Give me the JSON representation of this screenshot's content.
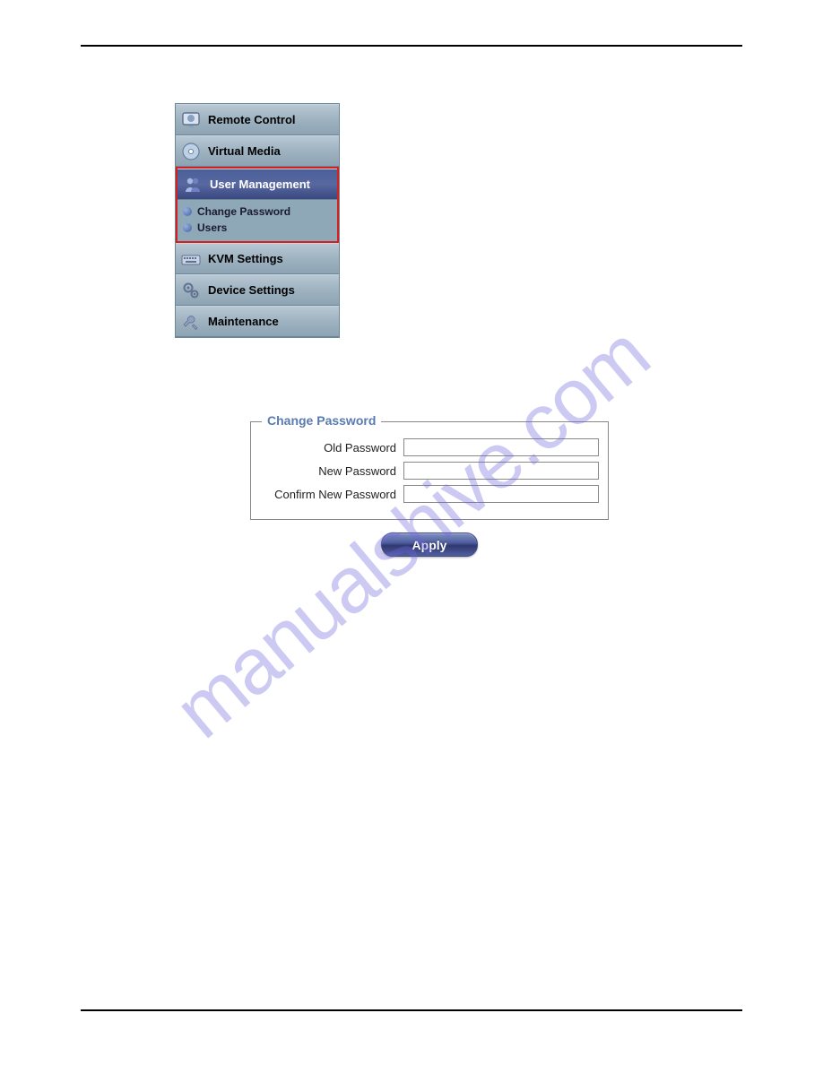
{
  "watermark": "manualshive.com",
  "sidebar": {
    "items": [
      {
        "label": "Remote Control",
        "icon": "monitor-icon",
        "selected": false
      },
      {
        "label": "Virtual Media",
        "icon": "disc-icon",
        "selected": false
      },
      {
        "label": "User Management",
        "icon": "users-icon",
        "selected": true,
        "submenu": [
          {
            "label": "Change Password"
          },
          {
            "label": "Users"
          }
        ]
      },
      {
        "label": "KVM Settings",
        "icon": "keyboard-icon",
        "selected": false
      },
      {
        "label": "Device Settings",
        "icon": "gears-icon",
        "selected": false
      },
      {
        "label": "Maintenance",
        "icon": "wrench-icon",
        "selected": false
      }
    ]
  },
  "form": {
    "legend": "Change Password",
    "fields": {
      "old_password_label": "Old Password",
      "old_password_value": "",
      "new_password_label": "New Password",
      "new_password_value": "",
      "confirm_password_label": "Confirm New Password",
      "confirm_password_value": ""
    },
    "apply_label": "Apply"
  }
}
